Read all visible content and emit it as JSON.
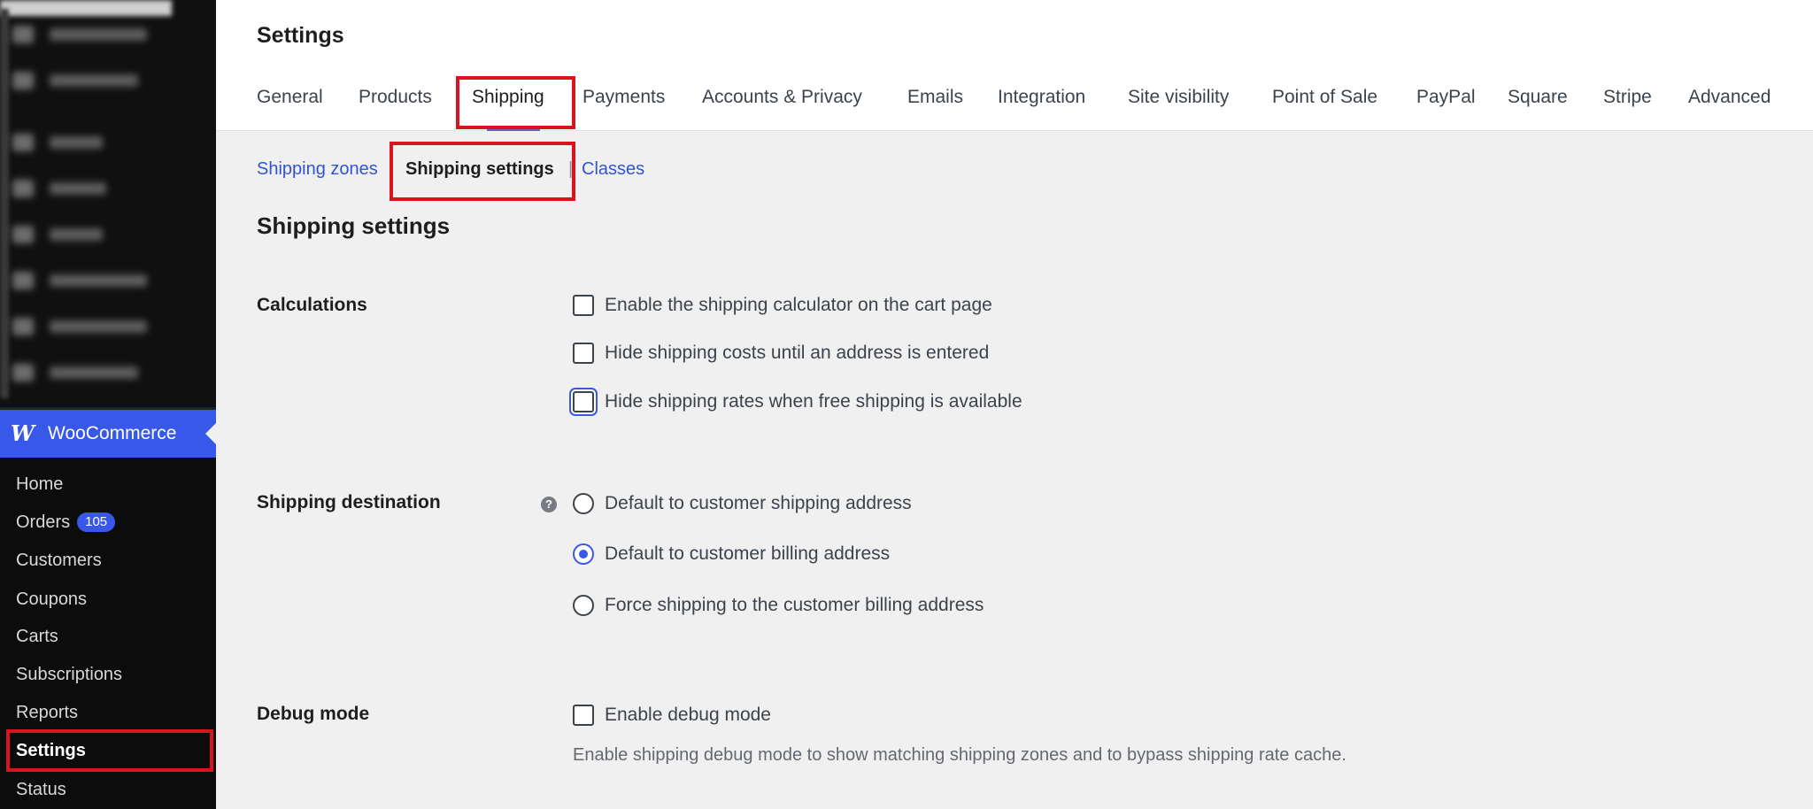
{
  "page_title": "Settings",
  "tabs": [
    {
      "label": "General"
    },
    {
      "label": "Products"
    },
    {
      "label": "Shipping"
    },
    {
      "label": "Payments"
    },
    {
      "label": "Accounts & Privacy"
    },
    {
      "label": "Emails"
    },
    {
      "label": "Integration"
    },
    {
      "label": "Site visibility"
    },
    {
      "label": "Point of Sale"
    },
    {
      "label": "PayPal"
    },
    {
      "label": "Square"
    },
    {
      "label": "Stripe"
    },
    {
      "label": "Advanced"
    }
  ],
  "active_tab": "Shipping",
  "subnav": {
    "zones": "Shipping zones",
    "settings": "Shipping settings",
    "classes": "Classes",
    "separator": "|"
  },
  "section_title": "Shipping settings",
  "calculations": {
    "label": "Calculations",
    "options": [
      {
        "label": "Enable the shipping calculator on the cart page",
        "checked": false
      },
      {
        "label": "Hide shipping costs until an address is entered",
        "checked": false
      },
      {
        "label": "Hide shipping rates when free shipping is available",
        "checked": false
      }
    ]
  },
  "destination": {
    "label": "Shipping destination",
    "help_icon": "?",
    "options": [
      {
        "label": "Default to customer shipping address",
        "selected": false
      },
      {
        "label": "Default to customer billing address",
        "selected": true
      },
      {
        "label": "Force shipping to the customer billing address",
        "selected": false
      }
    ]
  },
  "debug": {
    "label": "Debug mode",
    "option": "Enable debug mode",
    "checked": false,
    "description": "Enable shipping debug mode to show matching shipping zones and to bypass shipping rate cache."
  },
  "sidebar": {
    "woo_label": "WooCommerce",
    "woo_logo": "W",
    "items": [
      {
        "label": "Home"
      },
      {
        "label": "Orders",
        "badge": "105"
      },
      {
        "label": "Customers"
      },
      {
        "label": "Coupons"
      },
      {
        "label": "Carts"
      },
      {
        "label": "Subscriptions"
      },
      {
        "label": "Reports"
      },
      {
        "label": "Settings"
      },
      {
        "label": "Status"
      }
    ]
  },
  "colors": {
    "accent": "#3858e9",
    "highlight": "#d9141e",
    "tab_underline": "#7f54b3"
  }
}
